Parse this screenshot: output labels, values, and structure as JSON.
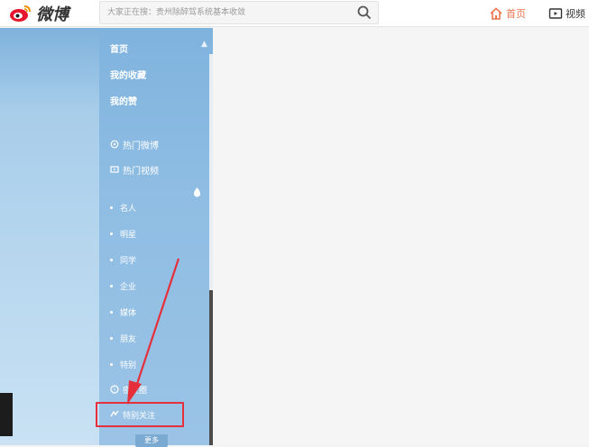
{
  "topbar": {
    "brand": "微博",
    "search": {
      "placeholder": "大家正在搜：贵州除醉驾系统基本收敛"
    },
    "nav_home_label": "首页",
    "nav_video_label": "视频"
  },
  "sidebar": {
    "main_items": [
      {
        "label": "首页"
      },
      {
        "label": "我的收藏"
      },
      {
        "label": "我的赞"
      }
    ],
    "hot_items": [
      {
        "label": "热门微博"
      },
      {
        "label": "热门视频"
      }
    ],
    "group_items": [
      {
        "label": "名人"
      },
      {
        "label": "明星"
      },
      {
        "label": "同学"
      },
      {
        "label": "企业"
      },
      {
        "label": "媒体"
      },
      {
        "label": "朋友"
      },
      {
        "label": "特别"
      },
      {
        "label": "密友圈"
      }
    ],
    "highlighted_item": {
      "label": "特别关注"
    },
    "more_button": "更多"
  },
  "colors": {
    "brand_accent": "#eb7350",
    "sidebar_bg": "#8fbde3",
    "highlight_border": "#e5303c"
  }
}
